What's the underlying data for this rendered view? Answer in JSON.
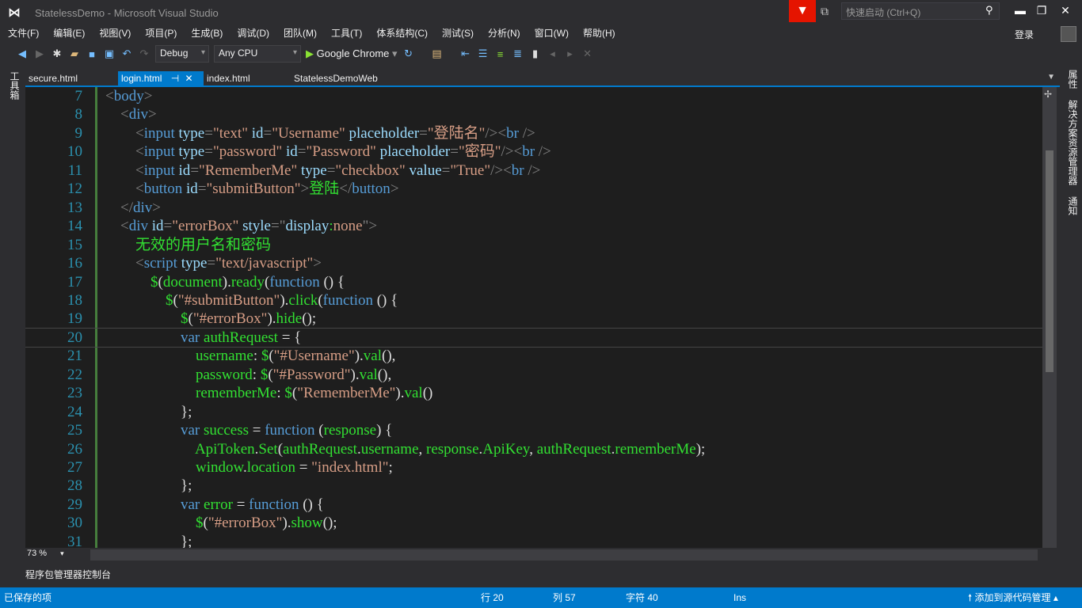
{
  "window": {
    "title": "StatelessDemo - Microsoft Visual Studio",
    "quick_launch_placeholder": "快速启动 (Ctrl+Q)",
    "login": "登录"
  },
  "menu": [
    "文件(F)",
    "编辑(E)",
    "视图(V)",
    "项目(P)",
    "生成(B)",
    "调试(D)",
    "团队(M)",
    "工具(T)",
    "体系结构(C)",
    "测试(S)",
    "分析(N)",
    "窗口(W)",
    "帮助(H)"
  ],
  "toolbar": {
    "config": "Debug",
    "platform": "Any CPU",
    "run_target": "Google Chrome"
  },
  "left_dock": "工具箱",
  "right_dock": [
    "属性",
    "解决方案资源管理器",
    "通知"
  ],
  "tabs": [
    {
      "label": "secure.html"
    },
    {
      "label": "login.html",
      "active": true
    },
    {
      "label": "index.html"
    },
    {
      "label": "StatelessDemoWeb"
    }
  ],
  "editor": {
    "zoom": "73 %",
    "current_line": 20,
    "lines": [
      {
        "n": "7",
        "tokens": [
          [
            "p",
            "<"
          ],
          [
            "t",
            "body"
          ],
          [
            "p",
            ">"
          ]
        ]
      },
      {
        "n": "8",
        "tokens": [
          [
            "w",
            "    "
          ],
          [
            "p",
            "<"
          ],
          [
            "t",
            "div"
          ],
          [
            "p",
            ">"
          ]
        ]
      },
      {
        "n": "9",
        "tokens": [
          [
            "w",
            "        "
          ],
          [
            "p",
            "<"
          ],
          [
            "t",
            "input"
          ],
          [
            "w",
            " "
          ],
          [
            "a",
            "type"
          ],
          [
            "p",
            "="
          ],
          [
            "s",
            "\"text\""
          ],
          [
            "w",
            " "
          ],
          [
            "a",
            "id"
          ],
          [
            "p",
            "="
          ],
          [
            "s",
            "\"Username\""
          ],
          [
            "w",
            " "
          ],
          [
            "a",
            "placeholder"
          ],
          [
            "p",
            "="
          ],
          [
            "s",
            "\"登陆名\""
          ],
          [
            "p",
            "/><"
          ],
          [
            "t",
            "br"
          ],
          [
            "w",
            " "
          ],
          [
            "p",
            "/>"
          ]
        ]
      },
      {
        "n": "10",
        "tokens": [
          [
            "w",
            "        "
          ],
          [
            "p",
            "<"
          ],
          [
            "t",
            "input"
          ],
          [
            "w",
            " "
          ],
          [
            "a",
            "type"
          ],
          [
            "p",
            "="
          ],
          [
            "s",
            "\"password\""
          ],
          [
            "w",
            " "
          ],
          [
            "a",
            "id"
          ],
          [
            "p",
            "="
          ],
          [
            "s",
            "\"Password\""
          ],
          [
            "w",
            " "
          ],
          [
            "a",
            "placeholder"
          ],
          [
            "p",
            "="
          ],
          [
            "s",
            "\"密码\""
          ],
          [
            "p",
            "/><"
          ],
          [
            "t",
            "br"
          ],
          [
            "w",
            " "
          ],
          [
            "p",
            "/>"
          ]
        ]
      },
      {
        "n": "11",
        "tokens": [
          [
            "w",
            "        "
          ],
          [
            "p",
            "<"
          ],
          [
            "t",
            "input"
          ],
          [
            "w",
            " "
          ],
          [
            "a",
            "id"
          ],
          [
            "p",
            "="
          ],
          [
            "s",
            "\"RememberMe\""
          ],
          [
            "w",
            " "
          ],
          [
            "a",
            "type"
          ],
          [
            "p",
            "="
          ],
          [
            "s",
            "\"checkbox\""
          ],
          [
            "w",
            " "
          ],
          [
            "a",
            "value"
          ],
          [
            "p",
            "="
          ],
          [
            "s",
            "\"True\""
          ],
          [
            "p",
            "/><"
          ],
          [
            "t",
            "br"
          ],
          [
            "w",
            " "
          ],
          [
            "p",
            "/>"
          ]
        ]
      },
      {
        "n": "12",
        "tokens": [
          [
            "w",
            "        "
          ],
          [
            "p",
            "<"
          ],
          [
            "t",
            "button"
          ],
          [
            "w",
            " "
          ],
          [
            "a",
            "id"
          ],
          [
            "p",
            "="
          ],
          [
            "s",
            "\"submitButton\""
          ],
          [
            "p",
            ">"
          ],
          [
            "g",
            "登陆"
          ],
          [
            "p",
            "</"
          ],
          [
            "t",
            "button"
          ],
          [
            "p",
            ">"
          ]
        ]
      },
      {
        "n": "13",
        "tokens": [
          [
            "w",
            "    "
          ],
          [
            "p",
            "</"
          ],
          [
            "t",
            "div"
          ],
          [
            "p",
            ">"
          ]
        ]
      },
      {
        "n": "14",
        "tokens": [
          [
            "w",
            "    "
          ],
          [
            "p",
            "<"
          ],
          [
            "t",
            "div"
          ],
          [
            "w",
            " "
          ],
          [
            "a",
            "id"
          ],
          [
            "p",
            "="
          ],
          [
            "s",
            "\"errorBox\""
          ],
          [
            "w",
            " "
          ],
          [
            "a",
            "style"
          ],
          [
            "p",
            "=\""
          ],
          [
            "a",
            "display"
          ],
          [
            "g",
            ":"
          ],
          [
            "s",
            "none"
          ],
          [
            "p",
            "\">"
          ]
        ]
      },
      {
        "n": "15",
        "tokens": [
          [
            "w",
            "        "
          ],
          [
            "g",
            "无效的用户名和密码"
          ]
        ]
      },
      {
        "n": "16",
        "tokens": [
          [
            "w",
            "        "
          ],
          [
            "p",
            "<"
          ],
          [
            "t",
            "script"
          ],
          [
            "w",
            " "
          ],
          [
            "a",
            "type"
          ],
          [
            "p",
            "="
          ],
          [
            "s",
            "\"text/javascript\""
          ],
          [
            "p",
            ">"
          ]
        ]
      },
      {
        "n": "17",
        "tokens": [
          [
            "w",
            "            "
          ],
          [
            "g",
            "$"
          ],
          [
            "w",
            "("
          ],
          [
            "g",
            "document"
          ],
          [
            "w",
            ")."
          ],
          [
            "g",
            "ready"
          ],
          [
            "w",
            "("
          ],
          [
            "k",
            "function"
          ],
          [
            "w",
            " () {"
          ]
        ]
      },
      {
        "n": "18",
        "tokens": [
          [
            "w",
            "                "
          ],
          [
            "g",
            "$"
          ],
          [
            "w",
            "("
          ],
          [
            "s",
            "\"#submitButton\""
          ],
          [
            "w",
            ")."
          ],
          [
            "g",
            "click"
          ],
          [
            "w",
            "("
          ],
          [
            "k",
            "function"
          ],
          [
            "w",
            " () {"
          ]
        ]
      },
      {
        "n": "19",
        "tokens": [
          [
            "w",
            "                    "
          ],
          [
            "g",
            "$"
          ],
          [
            "w",
            "("
          ],
          [
            "s",
            "\"#errorBox\""
          ],
          [
            "w",
            ")."
          ],
          [
            "g",
            "hide"
          ],
          [
            "w",
            "();"
          ]
        ]
      },
      {
        "n": "20",
        "tokens": [
          [
            "w",
            "                    "
          ],
          [
            "k",
            "var"
          ],
          [
            "w",
            " "
          ],
          [
            "g",
            "authRequest"
          ],
          [
            "w",
            " = {"
          ]
        ]
      },
      {
        "n": "21",
        "tokens": [
          [
            "w",
            "                        "
          ],
          [
            "g",
            "username"
          ],
          [
            "w",
            ": "
          ],
          [
            "g",
            "$"
          ],
          [
            "w",
            "("
          ],
          [
            "s",
            "\"#Username\""
          ],
          [
            "w",
            ")."
          ],
          [
            "g",
            "val"
          ],
          [
            "w",
            "(),"
          ]
        ]
      },
      {
        "n": "22",
        "tokens": [
          [
            "w",
            "                        "
          ],
          [
            "g",
            "password"
          ],
          [
            "w",
            ": "
          ],
          [
            "g",
            "$"
          ],
          [
            "w",
            "("
          ],
          [
            "s",
            "\"#Password\""
          ],
          [
            "w",
            ")."
          ],
          [
            "g",
            "val"
          ],
          [
            "w",
            "(),"
          ]
        ]
      },
      {
        "n": "23",
        "tokens": [
          [
            "w",
            "                        "
          ],
          [
            "g",
            "rememberMe"
          ],
          [
            "w",
            ": "
          ],
          [
            "g",
            "$"
          ],
          [
            "w",
            "("
          ],
          [
            "s",
            "\"RememberMe\""
          ],
          [
            "w",
            ")."
          ],
          [
            "g",
            "val"
          ],
          [
            "w",
            "()"
          ]
        ]
      },
      {
        "n": "24",
        "tokens": [
          [
            "w",
            "                    };"
          ]
        ]
      },
      {
        "n": "25",
        "tokens": [
          [
            "w",
            "                    "
          ],
          [
            "k",
            "var"
          ],
          [
            "w",
            " "
          ],
          [
            "g",
            "success"
          ],
          [
            "w",
            " = "
          ],
          [
            "k",
            "function"
          ],
          [
            "w",
            " ("
          ],
          [
            "g",
            "response"
          ],
          [
            "w",
            ") {"
          ]
        ]
      },
      {
        "n": "26",
        "tokens": [
          [
            "w",
            "                        "
          ],
          [
            "g",
            "ApiToken"
          ],
          [
            "w",
            "."
          ],
          [
            "g",
            "Set"
          ],
          [
            "w",
            "("
          ],
          [
            "g",
            "authRequest"
          ],
          [
            "w",
            "."
          ],
          [
            "g",
            "username"
          ],
          [
            "w",
            ", "
          ],
          [
            "g",
            "response"
          ],
          [
            "w",
            "."
          ],
          [
            "g",
            "ApiKey"
          ],
          [
            "w",
            ", "
          ],
          [
            "g",
            "authRequest"
          ],
          [
            "w",
            "."
          ],
          [
            "g",
            "rememberMe"
          ],
          [
            "w",
            ");"
          ]
        ]
      },
      {
        "n": "27",
        "tokens": [
          [
            "w",
            "                        "
          ],
          [
            "g",
            "window"
          ],
          [
            "w",
            "."
          ],
          [
            "g",
            "location"
          ],
          [
            "w",
            " = "
          ],
          [
            "s",
            "\"index.html\""
          ],
          [
            "w",
            ";"
          ]
        ]
      },
      {
        "n": "28",
        "tokens": [
          [
            "w",
            "                    };"
          ]
        ]
      },
      {
        "n": "29",
        "tokens": [
          [
            "w",
            "                    "
          ],
          [
            "k",
            "var"
          ],
          [
            "w",
            " "
          ],
          [
            "g",
            "error"
          ],
          [
            "w",
            " = "
          ],
          [
            "k",
            "function"
          ],
          [
            "w",
            " () {"
          ]
        ]
      },
      {
        "n": "30",
        "tokens": [
          [
            "w",
            "                        "
          ],
          [
            "g",
            "$"
          ],
          [
            "w",
            "("
          ],
          [
            "s",
            "\"#errorBox\""
          ],
          [
            "w",
            ")."
          ],
          [
            "g",
            "show"
          ],
          [
            "w",
            "();"
          ]
        ]
      },
      {
        "n": "31",
        "tokens": [
          [
            "w",
            "                    };"
          ]
        ]
      }
    ]
  },
  "output_tab": "程序包管理器控制台",
  "status": {
    "message": "已保存的项",
    "line": "行 20",
    "col": "列 57",
    "char": "字符 40",
    "mode": "Ins",
    "source_control": "添加到源代码管理"
  },
  "colors": {
    "accent": "#007acc",
    "tag": "#569cd6",
    "attribute": "#9cdcfe",
    "string": "#d69d85",
    "identifier": "#32e032",
    "line_number": "#2b91af",
    "filter": "#e51400"
  }
}
